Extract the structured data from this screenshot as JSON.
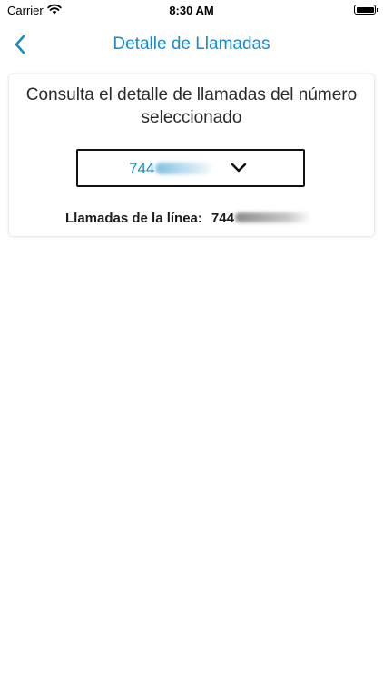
{
  "status_bar": {
    "carrier": "Carrier",
    "time": "8:30 AM",
    "icons": [
      "wifi-icon",
      "battery-icon"
    ]
  },
  "nav": {
    "title": "Detalle de Llamadas",
    "back_icon": "chevron-left-icon",
    "accent_color": "#1a8ac8"
  },
  "card": {
    "description": "Consulta el detalle de llamadas del número seleccionado",
    "selector": {
      "value_visible": "744",
      "value_obscured": true,
      "icon": "chevron-down-icon"
    },
    "line_label": "Llamadas de la línea:",
    "line_value_visible": "744",
    "line_value_obscured": true
  }
}
